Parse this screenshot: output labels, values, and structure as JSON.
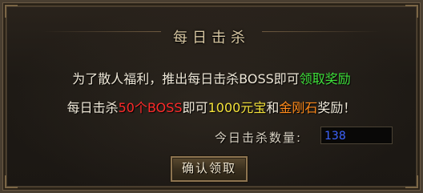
{
  "dialog": {
    "title": "每日击杀",
    "line1": {
      "part1": "为了散人福利，推出每日击杀BOSS即可",
      "highlight": "领取奖励"
    },
    "line2": {
      "part1": "每日击杀",
      "boss_count": "50个BOSS",
      "part2": "即可",
      "ingot": "1000元宝",
      "part3": "和",
      "diamond": "金刚石",
      "part4": "奖励！"
    },
    "kill_count_label": "今日击杀数量:",
    "kill_count_value": "138",
    "confirm_button": "确认领取"
  },
  "colors": {
    "highlight_green": "#3ee03a",
    "boss_red": "#ff2a2a",
    "ingot_yellow": "#f4e23a",
    "diamond_orange": "#ff8a1a",
    "count_blue": "#3d64ff"
  }
}
